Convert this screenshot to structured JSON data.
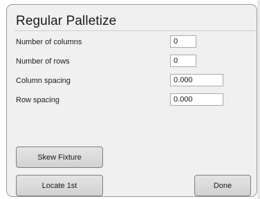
{
  "dialog": {
    "title": "Regular Palletize"
  },
  "fields": [
    {
      "label": "Number of columns",
      "value": "0"
    },
    {
      "label": "Number of rows",
      "value": "0"
    },
    {
      "label": "Column spacing",
      "value": "0.000"
    },
    {
      "label": "Row spacing",
      "value": "0.000"
    }
  ],
  "buttons": {
    "skew_fixture": "Skew Fixture",
    "locate_first": "Locate 1st",
    "done": "Done"
  }
}
